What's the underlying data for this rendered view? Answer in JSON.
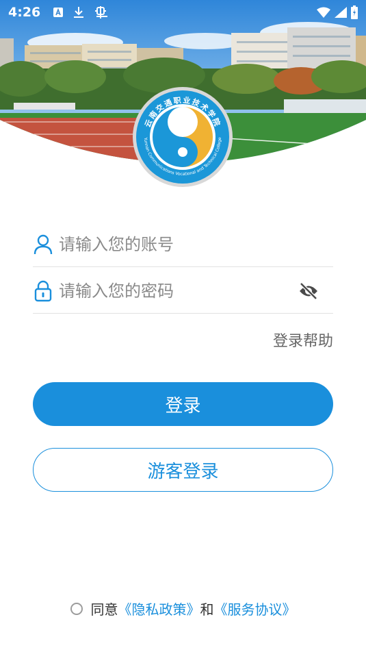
{
  "status_bar": {
    "time": "4:26",
    "left_icons": [
      "text-recognition-icon",
      "download-icon",
      "bug-icon"
    ],
    "right_icons": [
      "wifi-icon",
      "signal-icon",
      "battery-charging-icon"
    ]
  },
  "logo": {
    "circle_text": "云南交通职业技术学院",
    "circle_text_en": "Yunnan Communications Vocational and Technical College"
  },
  "form": {
    "account_placeholder": "请输入您的账号",
    "password_placeholder": "请输入您的密码",
    "help_label": "登录帮助"
  },
  "buttons": {
    "login_label": "登录",
    "guest_label": "游客登录"
  },
  "agreement": {
    "prefix": "同意",
    "privacy_link": "《隐私政策》",
    "conjunction": "和",
    "service_link": "《服务协议》"
  },
  "colors": {
    "primary": "#1a8fdc",
    "logo_blue": "#1b97d8",
    "logo_yellow": "#f0b233"
  }
}
